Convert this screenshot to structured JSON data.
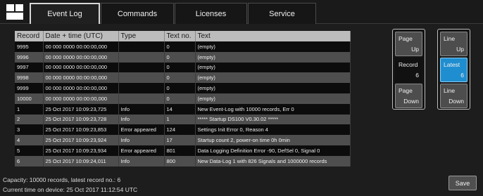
{
  "tabs": [
    {
      "label": "Event Log"
    },
    {
      "label": "Commands"
    },
    {
      "label": "Licenses"
    },
    {
      "label": "Service"
    }
  ],
  "table": {
    "headers": [
      "Record",
      "Date + time (UTC)",
      "Type",
      "Text no.",
      "Text"
    ],
    "rows": [
      {
        "record": "9995",
        "datetime": "00 000 0000 00:00:00,000",
        "type": "",
        "textno": "0",
        "text": "(empty)"
      },
      {
        "record": "9996",
        "datetime": "00 000 0000 00:00:00,000",
        "type": "",
        "textno": "0",
        "text": "(empty)"
      },
      {
        "record": "9997",
        "datetime": "00 000 0000 00:00:00,000",
        "type": "",
        "textno": "0",
        "text": "(empty)"
      },
      {
        "record": "9998",
        "datetime": "00 000 0000 00:00:00,000",
        "type": "",
        "textno": "0",
        "text": "(empty)"
      },
      {
        "record": "9999",
        "datetime": "00 000 0000 00:00:00,000",
        "type": "",
        "textno": "0",
        "text": "(empty)"
      },
      {
        "record": "10000",
        "datetime": "00 000 0000 00:00:00,000",
        "type": "",
        "textno": "0",
        "text": "(empty)"
      },
      {
        "record": "1",
        "datetime": "25 Oct 2017 10:09:23,725",
        "type": "Info",
        "textno": "14",
        "text": "New Event-Log with 10000 records, Err 0"
      },
      {
        "record": "2",
        "datetime": "25 Oct 2017 10:09:23,728",
        "type": "Info",
        "textno": "1",
        "text": "***** Startup DS100 V0.30.02 *****"
      },
      {
        "record": "3",
        "datetime": "25 Oct 2017 10:09:23,853",
        "type": "Error appeared",
        "textno": "124",
        "text": "Settings Init Error 0, Reason 4"
      },
      {
        "record": "4",
        "datetime": "25 Oct 2017 10:09:23,924",
        "type": "Info",
        "textno": "17",
        "text": "Startup count 2, power-on time 0h 0min"
      },
      {
        "record": "5",
        "datetime": "25 Oct 2017 10:09:23,934",
        "type": "Error appeared",
        "textno": "801",
        "text": "Data Logging Definition Error -90, DefSel 0, Signal 0"
      },
      {
        "record": "6",
        "datetime": "25 Oct 2017 10:09:24,011",
        "type": "Info",
        "textno": "800",
        "text": "New Data-Log 1 with 826 Signals and 1000000 records"
      }
    ]
  },
  "status": {
    "capacity": "Capacity: 10000 records, latest record no.: 6",
    "current_time": "Current time on device: 25 Oct 2017 11:12:54 UTC"
  },
  "record_panel": {
    "page_up": {
      "line1": "Page",
      "line2": "Up"
    },
    "record": {
      "line1": "Record",
      "line2": "6"
    },
    "page_down": {
      "line1": "Page",
      "line2": "Down"
    }
  },
  "line_panel": {
    "line_up": {
      "line1": "Line",
      "line2": "Up"
    },
    "latest": {
      "line1": "Latest",
      "line2": "6"
    },
    "line_down": {
      "line1": "Line",
      "line2": "Down"
    }
  },
  "save_label": "Save",
  "colors": {
    "background": "#1d1d1d",
    "header_bg": "#bcbcbc",
    "row_dark": "#0c0c0c",
    "row_gray": "#4e4e4e",
    "accent_blue": "#1f8ed0"
  }
}
